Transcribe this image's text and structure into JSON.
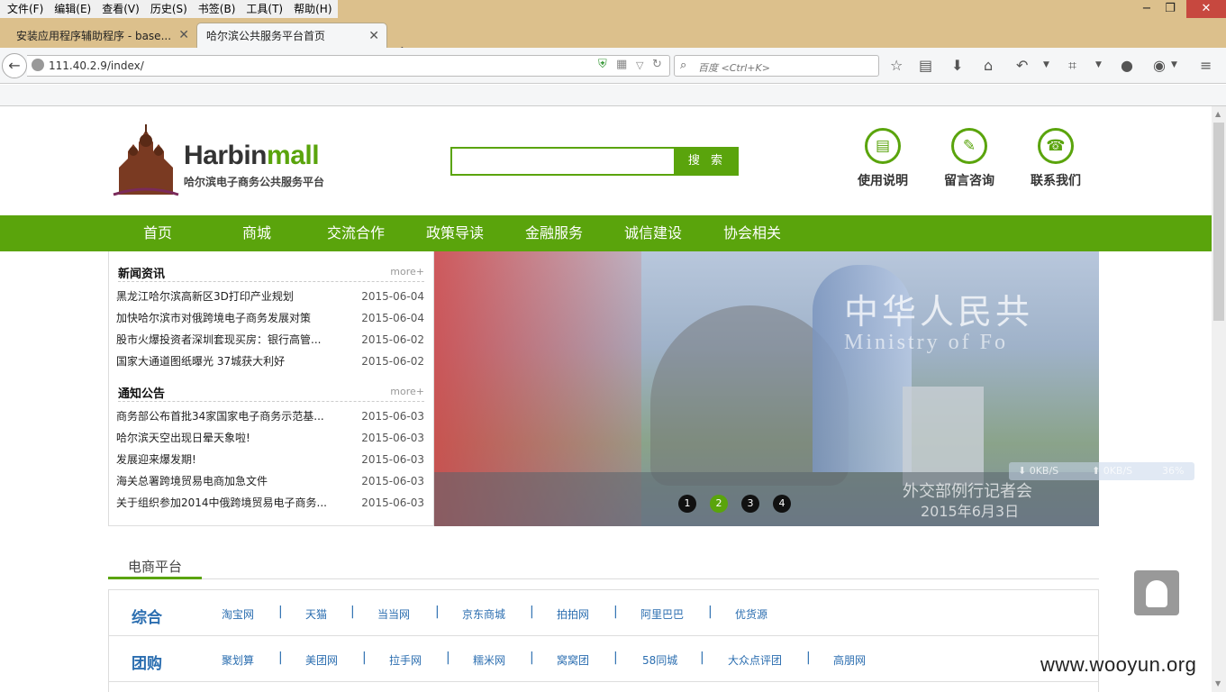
{
  "browser": {
    "menu": [
      "文件(F)",
      "编辑(E)",
      "查看(V)",
      "历史(S)",
      "书签(B)",
      "工具(T)",
      "帮助(H)"
    ],
    "window_controls": {
      "minimize": "−",
      "maximize": "❐",
      "close": "✕"
    },
    "tabs": [
      {
        "title": "安装应用程序辅助程序 - base..."
      },
      {
        "title": "哈尔滨公共服务平台首页"
      }
    ],
    "url": "111.40.2.9/index/",
    "search_placeholder": "百度 <Ctrl+K>"
  },
  "site": {
    "logo_main": "Harbin",
    "logo_accent": "mall",
    "logo_sub": "哈尔滨电子商务公共服务平台",
    "search_button": "搜 索",
    "top_links": [
      {
        "label": "使用说明",
        "icon": "manual-icon"
      },
      {
        "label": "留言咨询",
        "icon": "message-icon"
      },
      {
        "label": "联系我们",
        "icon": "phone-icon"
      }
    ],
    "nav": [
      "首页",
      "商城",
      "交流合作",
      "政策导读",
      "金融服务",
      "诚信建设",
      "协会相关"
    ],
    "news": {
      "title": "新闻资讯",
      "more": "more+",
      "items": [
        {
          "title": "黑龙江哈尔滨高新区3D打印产业规划",
          "date": "2015-06-04"
        },
        {
          "title": "加快哈尔滨市对俄跨境电子商务发展对策",
          "date": "2015-06-04"
        },
        {
          "title": "股市火爆投资者深圳套现买房：银行高管...",
          "date": "2015-06-02"
        },
        {
          "title": "国家大通道图纸曝光 37城获大利好",
          "date": "2015-06-02"
        }
      ]
    },
    "notices": {
      "title": "通知公告",
      "more": "more+",
      "items": [
        {
          "title": "商务部公布首批34家国家电子商务示范基...",
          "date": "2015-06-03"
        },
        {
          "title": "哈尔滨天空出现日晕天象啦!",
          "date": "2015-06-03"
        },
        {
          "title": "发展迎来爆发期!",
          "date": "2015-06-03"
        },
        {
          "title": "海关总署跨境贸易电商加急文件",
          "date": "2015-06-03"
        },
        {
          "title": "关于组织参加2014中俄跨境贸易电子商务...",
          "date": "2015-06-03"
        }
      ]
    },
    "banner": {
      "text_cn": "中华人民共",
      "text_en": "Ministry of Fo",
      "caption": "外交部例行记者会",
      "date_text": "2015年6月3日",
      "dots": [
        "1",
        "2",
        "3",
        "4"
      ],
      "active_dot": 2
    },
    "net_meter": {
      "down": "0KB/S",
      "up": "0KB/S",
      "percent": "36%"
    },
    "platform": {
      "title": "电商平台",
      "rows": [
        {
          "category": "综合",
          "links": [
            "淘宝网",
            "天猫",
            "当当网",
            "京东商城",
            "拍拍网",
            "阿里巴巴",
            "优货源"
          ]
        },
        {
          "category": "团购",
          "links": [
            "聚划算",
            "美团网",
            "拉手网",
            "糯米网",
            "窝窝团",
            "58同城",
            "大众点评团",
            "高朋网"
          ]
        }
      ]
    },
    "watermark": "www.wooyun.org"
  }
}
